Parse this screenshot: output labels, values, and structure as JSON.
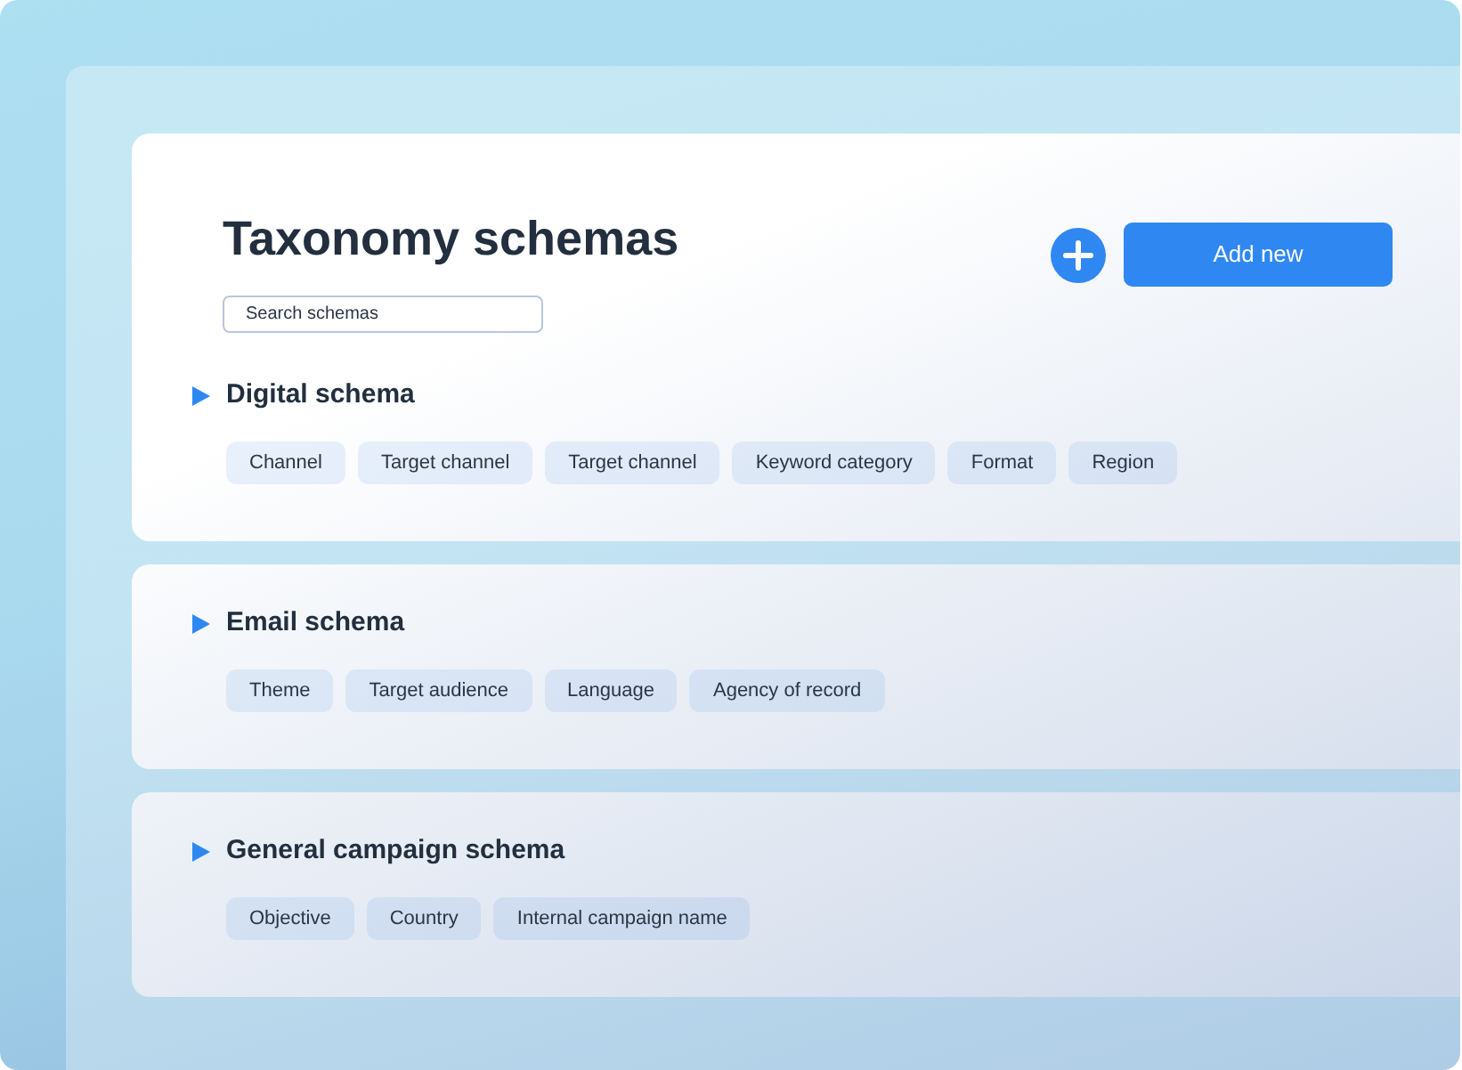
{
  "page": {
    "title": "Taxonomy schemas",
    "search": {
      "placeholder": "Search schemas"
    },
    "add_button": "Add new"
  },
  "schemas": [
    {
      "name": "Digital schema",
      "fields": [
        "Channel",
        "Target channel",
        "Target channel",
        "Keyword category",
        "Format",
        "Region"
      ]
    },
    {
      "name": "Email schema",
      "fields": [
        "Theme",
        "Target audience",
        "Language",
        "Agency of record"
      ]
    },
    {
      "name": "General campaign schema",
      "fields": [
        "Objective",
        "Country",
        "Internal campaign name"
      ]
    }
  ]
}
